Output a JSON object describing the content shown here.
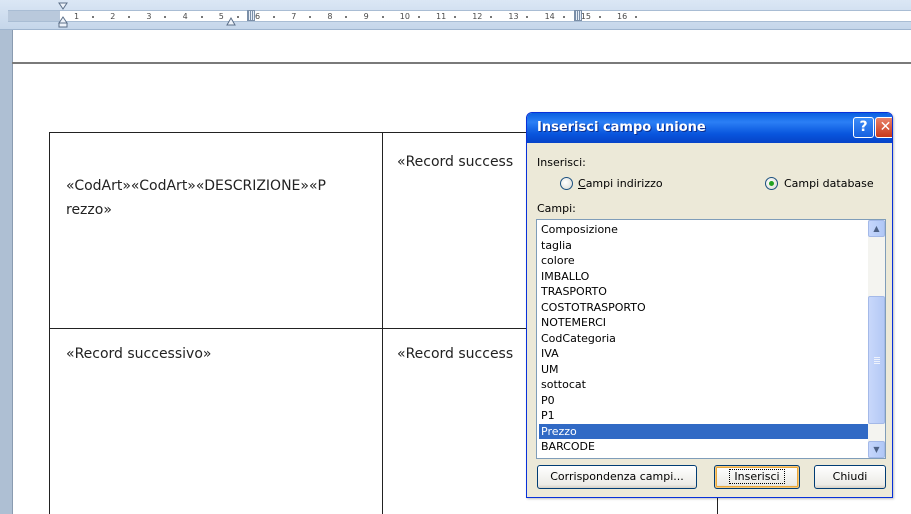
{
  "ruler": {
    "numbers": [
      "1",
      "2",
      "3",
      "4",
      "5",
      "6",
      "7",
      "8",
      "9",
      "10",
      "11",
      "12",
      "13",
      "14",
      "15",
      "16"
    ]
  },
  "table": {
    "cells": [
      "«CodArt»«CodArt»«DESCRIZIONE»«P",
      "rezzo»",
      "«Record success",
      "«Record successivo»",
      "«Record success"
    ]
  },
  "dialog": {
    "title": "Inserisci campo unione",
    "help_glyph": "?",
    "close_glyph": "✕",
    "insert_label": "Inserisci:",
    "radio_address_label": "Campi indirizzo",
    "radio_database_label": "Campi database",
    "radio_selected": "database",
    "fields_label": "Campi:",
    "fields": [
      "Composizione",
      "taglia",
      "colore",
      "IMBALLO",
      "TRASPORTO",
      "COSTOTRASPORTO",
      "NOTEMERCI",
      "CodCategoria",
      "IVA",
      "UM",
      "sottocat",
      "P0",
      "P1",
      "Prezzo",
      "BARCODE"
    ],
    "selected_field": "Prezzo",
    "buttons": {
      "match": "Corrispondenza campi...",
      "insert": "Inserisci",
      "close": "Chiudi"
    }
  },
  "colors": {
    "titlebar": "#0855dd",
    "selection": "#316ac5",
    "dialog_bg": "#ece9d8"
  }
}
